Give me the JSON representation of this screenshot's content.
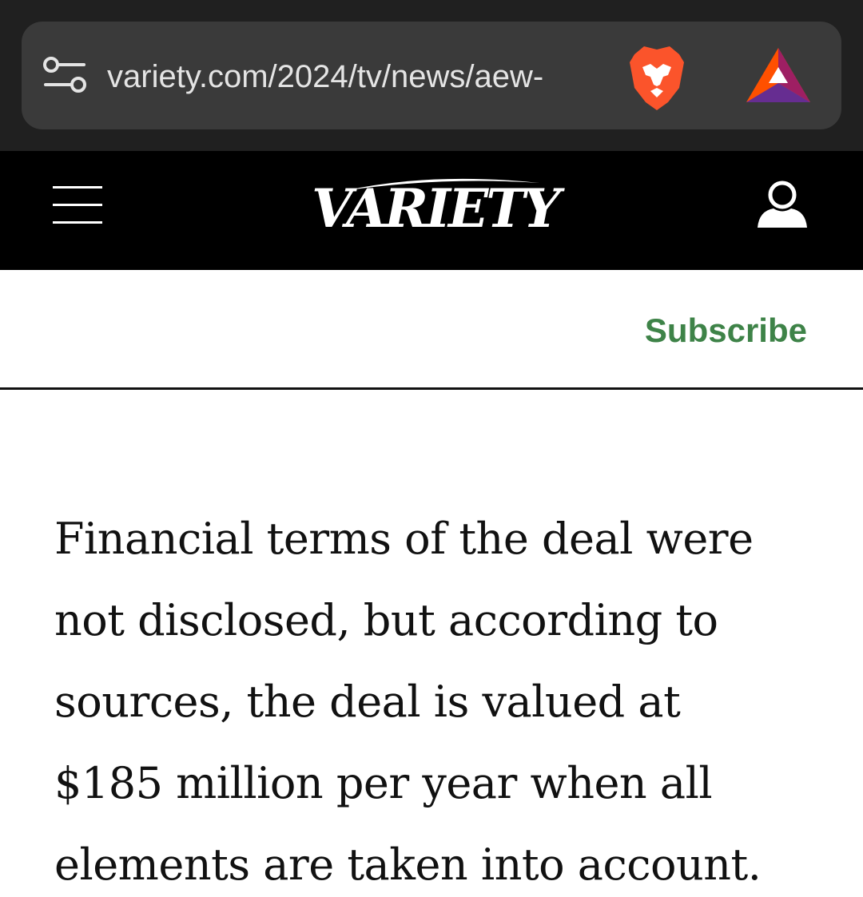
{
  "browser": {
    "url": "variety.com/2024/tv/news/aew-",
    "icons": [
      "site-settings-icon",
      "brave-shields-icon",
      "brave-rewards-icon"
    ]
  },
  "header": {
    "logo": "VARIETY",
    "icons": [
      "menu-icon",
      "account-icon"
    ]
  },
  "subscribe": {
    "label": "Subscribe",
    "color": "#3e8348"
  },
  "article": {
    "lines": [
      "Financial terms of the deal were",
      "not disclosed, but according to",
      "sources, the deal is valued at",
      "$185 million per year when all",
      "elements are taken into account."
    ]
  },
  "colors": {
    "browser_bg": "#202020",
    "url_pill": "#3a3a3a",
    "header_bg": "#000000",
    "brave_orange": "#fb542b"
  }
}
